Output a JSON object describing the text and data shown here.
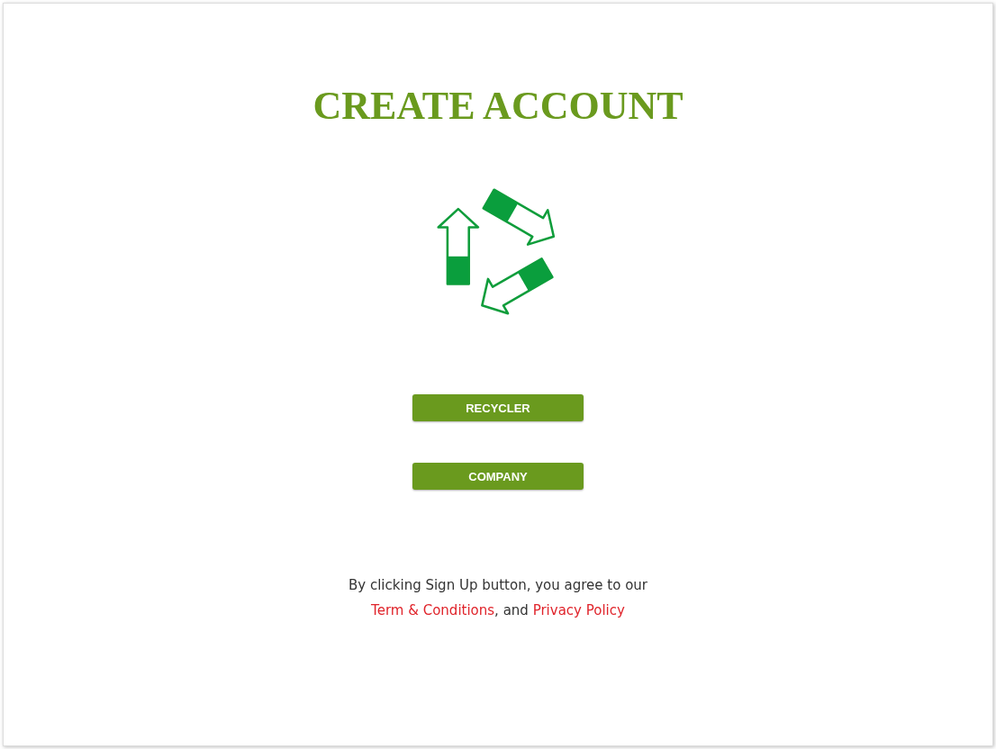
{
  "title": "CREATE ACCOUNT",
  "buttons": [
    {
      "label": "RECYCLER"
    },
    {
      "label": "COMPANY"
    }
  ],
  "notice": [
    {
      "kind": "text",
      "text": "By clicking Sign Up button, you agree to our"
    },
    {
      "kind": "break"
    },
    {
      "kind": "link",
      "text": "Term & Conditions"
    },
    {
      "kind": "text",
      "text": ", and "
    },
    {
      "kind": "link",
      "text": "Privacy Policy"
    }
  ]
}
